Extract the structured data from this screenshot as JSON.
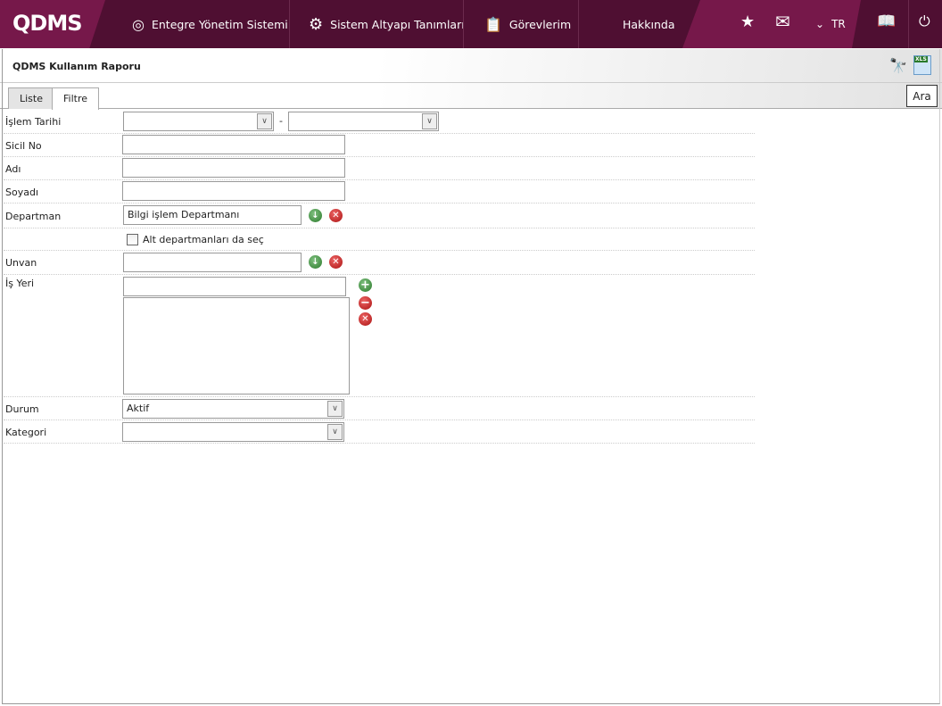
{
  "header": {
    "logo": "QDMS",
    "nav": [
      "Entegre Yönetim Sistemi",
      "Sistem Altyapı Tanımları",
      "Görevlerim",
      "Hakkında"
    ],
    "lang": "TR"
  },
  "page": {
    "title": "QDMS Kullanım Raporu",
    "tabs": [
      "Liste",
      "Filtre"
    ],
    "active_tab": "Filtre",
    "search_button": "Ara"
  },
  "form": {
    "islem_tarihi": "İşlem Tarihi",
    "date_sep": "-",
    "sicil_no": "Sicil No",
    "adi": "Adı",
    "soyadi": "Soyadı",
    "departman": "Departman",
    "departman_value": "Bilgi işlem Departmanı",
    "alt_departman": "Alt departmanları da seç",
    "unvan": "Unvan",
    "is_yeri": "İş Yeri",
    "durum": "Durum",
    "durum_value": "Aktif",
    "kategori": "Kategori"
  }
}
